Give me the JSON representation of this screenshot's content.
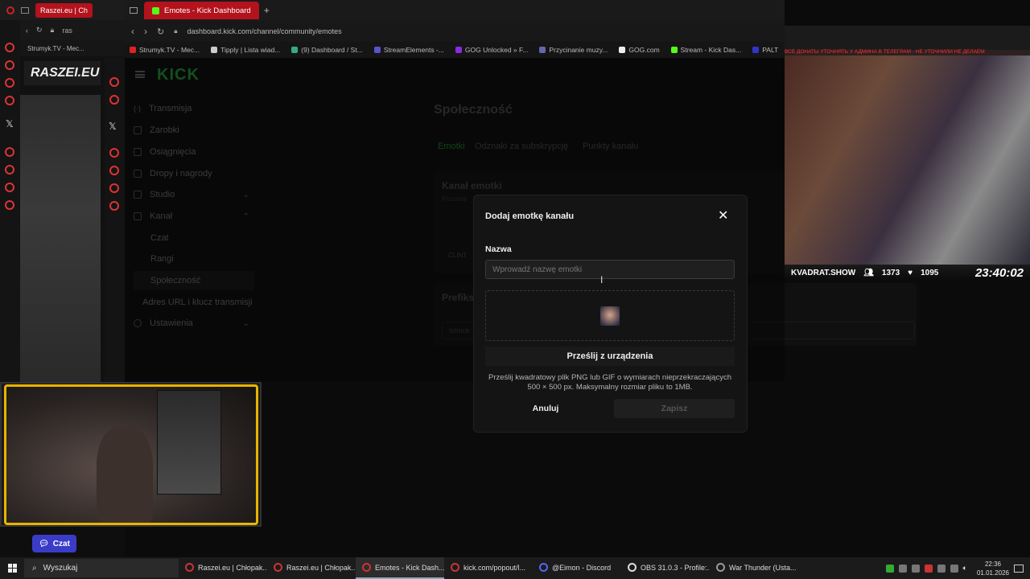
{
  "left_browser": {
    "tab_label": "Raszei.eu | Ch",
    "url": "ras",
    "bookmark": "Strumyk.TV - Mec...",
    "logo": "RASZEI.EU"
  },
  "browser": {
    "active_tab": "Emotes - Kick Dashboard",
    "new_tab_symbol": "+",
    "url": "dashboard.kick.com/channel/community/emotes",
    "bookmarks": [
      "Strumyk.TV - Mec...",
      "Tipply | Lista wiad...",
      "(9) Dashboard / St...",
      "StreamElements -...",
      "GOG Unlocked » F...",
      "Przycinanie muzy...",
      "GOG.com",
      "Stream - Kick Das...",
      "PALT"
    ]
  },
  "kick": {
    "logo": "KICK",
    "nav": {
      "transmisja": "Transmisja",
      "zarobki": "Zarobki",
      "osiagniecia": "Osiągnięcia",
      "dropy": "Dropy i nagrody",
      "studio": "Studio",
      "kanal": "Kanał",
      "czat": "Czat",
      "rangi": "Rangi",
      "spolecznosc": "Społeczność",
      "adres_url": "Adres URL i klucz transmisji",
      "ustawienia": "Ustawienia"
    },
    "page_title": "Społeczność",
    "tabs": [
      "Emotki",
      "Odznaki za subskrypcję",
      "Punkty kanału"
    ],
    "section_emotes": "Kanał emotki",
    "section_emotes_sub": "Pozostał",
    "emote_name": "CLINT",
    "section_prefix": "Prefiks",
    "prefix_value": "lotnick"
  },
  "modal": {
    "title": "Dodaj emotkę kanału",
    "close_symbol": "✕",
    "name_label": "Nazwa",
    "name_placeholder": "Wprowadź nazwę emotki",
    "upload_label": "Prześlij z urządzenia",
    "upload_hint": "Prześlij kwadratowy plik PNG lub GIF o wymiarach nieprzekraczających 500 × 500 px. Maksymalny rozmiar pliku to 1MB.",
    "cancel_label": "Anuluj",
    "save_label": "Zapisz"
  },
  "stream_overlay": {
    "ticker": "ВСЕ ДОНАТЫ УТОЧНЯТЬ У АДМИНА В ТЕЛЕГРАМ - НЕ УТОЧНИЛИ НЕ ДЕЛАЕМ",
    "channel": "KVADRAT.SHOW",
    "viewers": "1373",
    "likes": "1095",
    "clock": "23:40:02"
  },
  "chat_button": "Czat",
  "taskbar": {
    "search_label": "Wyszukaj",
    "tasks": [
      "Raszei.eu | Chłopak...",
      "Raszei.eu | Chłopak...",
      "Emotes - Kick Dash...",
      "kick.com/popout/l...",
      "@Eimon - Discord",
      "OBS 31.0.3 - Profile:...",
      "War Thunder (Usta..."
    ],
    "time": "22:36",
    "date": "01.01.2026"
  }
}
